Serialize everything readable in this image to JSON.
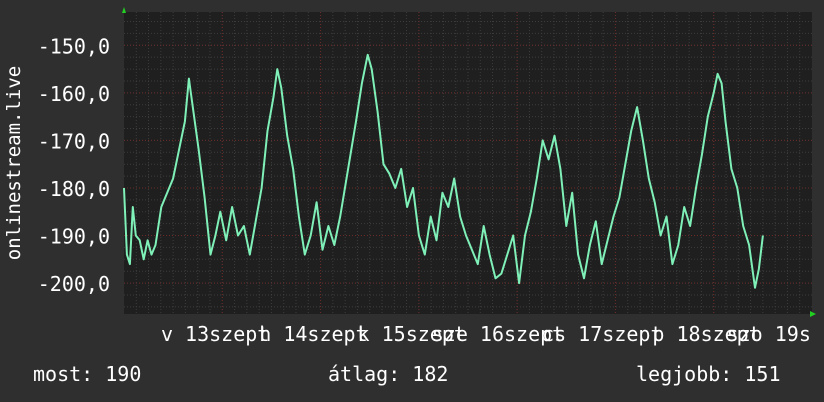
{
  "colors": {
    "background": "#2f2f2f",
    "plot_background": "#1f1f1f",
    "grid_minor": "#3d3d3d",
    "grid_major": "#6b2a2a",
    "line": "#7ff0b8",
    "axis_arrow": "#22d022",
    "text": "#ffffff"
  },
  "chart_data": {
    "type": "line",
    "title": "",
    "xlabel": "",
    "ylabel": "onlinestream.live",
    "ylim": [
      -206.5,
      -143
    ],
    "xlim": [
      0,
      7
    ],
    "grid": true,
    "y_ticks": [
      -150,
      -160,
      -170,
      -180,
      -190,
      -200
    ],
    "y_tick_labels": [
      "-150,0",
      "-160,0",
      "-170,0",
      "-180,0",
      "-190,0",
      "-200,0"
    ],
    "x_ticks": [
      {
        "pos": 0.5,
        "label": "v 13"
      },
      {
        "pos": 1.5,
        "label": "h 14"
      },
      {
        "pos": 2.5,
        "label": "k 15"
      },
      {
        "pos": 3.5,
        "label": "sze 16"
      },
      {
        "pos": 4.5,
        "label": "cs 17"
      },
      {
        "pos": 5.5,
        "label": "p 18"
      },
      {
        "pos": 6.5,
        "label": "szo 19"
      }
    ],
    "x_tick_labels_overlap": [
      "szept",
      "szept",
      "szept",
      "szept",
      "szept",
      "szept",
      "s"
    ],
    "series": [
      {
        "values": [
          [
            0.0,
            -180
          ],
          [
            0.03,
            -194
          ],
          [
            0.06,
            -196
          ],
          [
            0.09,
            -184
          ],
          [
            0.12,
            -190
          ],
          [
            0.16,
            -191
          ],
          [
            0.2,
            -195
          ],
          [
            0.24,
            -191
          ],
          [
            0.28,
            -194
          ],
          [
            0.32,
            -192
          ],
          [
            0.38,
            -184
          ],
          [
            0.44,
            -181
          ],
          [
            0.5,
            -178
          ],
          [
            0.56,
            -172
          ],
          [
            0.62,
            -166
          ],
          [
            0.66,
            -157
          ],
          [
            0.7,
            -163
          ],
          [
            0.76,
            -172
          ],
          [
            0.82,
            -182
          ],
          [
            0.88,
            -194
          ],
          [
            0.93,
            -190
          ],
          [
            0.98,
            -185
          ],
          [
            1.04,
            -191
          ],
          [
            1.1,
            -184
          ],
          [
            1.16,
            -190
          ],
          [
            1.22,
            -188
          ],
          [
            1.28,
            -194
          ],
          [
            1.34,
            -187
          ],
          [
            1.4,
            -180
          ],
          [
            1.46,
            -168
          ],
          [
            1.52,
            -161
          ],
          [
            1.56,
            -155
          ],
          [
            1.6,
            -159
          ],
          [
            1.66,
            -169
          ],
          [
            1.72,
            -176
          ],
          [
            1.78,
            -186
          ],
          [
            1.84,
            -194
          ],
          [
            1.9,
            -190
          ],
          [
            1.96,
            -183
          ],
          [
            2.02,
            -193
          ],
          [
            2.08,
            -188
          ],
          [
            2.14,
            -192
          ],
          [
            2.2,
            -186
          ],
          [
            2.28,
            -176
          ],
          [
            2.36,
            -166
          ],
          [
            2.42,
            -158
          ],
          [
            2.48,
            -152
          ],
          [
            2.52,
            -155
          ],
          [
            2.58,
            -164
          ],
          [
            2.64,
            -175
          ],
          [
            2.7,
            -177
          ],
          [
            2.76,
            -180
          ],
          [
            2.82,
            -176
          ],
          [
            2.88,
            -184
          ],
          [
            2.94,
            -180
          ],
          [
            3.0,
            -190
          ],
          [
            3.06,
            -194
          ],
          [
            3.12,
            -186
          ],
          [
            3.18,
            -191
          ],
          [
            3.24,
            -181
          ],
          [
            3.3,
            -184
          ],
          [
            3.36,
            -178
          ],
          [
            3.42,
            -186
          ],
          [
            3.48,
            -190
          ],
          [
            3.54,
            -193
          ],
          [
            3.6,
            -196
          ],
          [
            3.66,
            -188
          ],
          [
            3.72,
            -194
          ],
          [
            3.78,
            -199
          ],
          [
            3.84,
            -198
          ],
          [
            3.9,
            -194
          ],
          [
            3.96,
            -190
          ],
          [
            4.02,
            -200
          ],
          [
            4.08,
            -190
          ],
          [
            4.14,
            -185
          ],
          [
            4.2,
            -178
          ],
          [
            4.26,
            -170
          ],
          [
            4.32,
            -174
          ],
          [
            4.38,
            -169
          ],
          [
            4.44,
            -176
          ],
          [
            4.5,
            -188
          ],
          [
            4.56,
            -181
          ],
          [
            4.62,
            -194
          ],
          [
            4.68,
            -199
          ],
          [
            4.74,
            -192
          ],
          [
            4.8,
            -187
          ],
          [
            4.86,
            -196
          ],
          [
            4.92,
            -191
          ],
          [
            4.98,
            -186
          ],
          [
            5.04,
            -182
          ],
          [
            5.1,
            -175
          ],
          [
            5.16,
            -168
          ],
          [
            5.22,
            -163
          ],
          [
            5.28,
            -170
          ],
          [
            5.34,
            -178
          ],
          [
            5.4,
            -183
          ],
          [
            5.46,
            -190
          ],
          [
            5.52,
            -186
          ],
          [
            5.58,
            -196
          ],
          [
            5.64,
            -192
          ],
          [
            5.7,
            -184
          ],
          [
            5.76,
            -188
          ],
          [
            5.82,
            -180
          ],
          [
            5.88,
            -173
          ],
          [
            5.94,
            -165
          ],
          [
            6.0,
            -160
          ],
          [
            6.04,
            -156
          ],
          [
            6.08,
            -158
          ],
          [
            6.12,
            -166
          ],
          [
            6.18,
            -176
          ],
          [
            6.24,
            -180
          ],
          [
            6.3,
            -188
          ],
          [
            6.36,
            -192
          ],
          [
            6.42,
            -201
          ],
          [
            6.46,
            -197
          ],
          [
            6.5,
            -190
          ]
        ]
      }
    ]
  },
  "stats": {
    "now": "most: 190",
    "avg": "átlag: 182",
    "best": "legjobb: 151"
  }
}
